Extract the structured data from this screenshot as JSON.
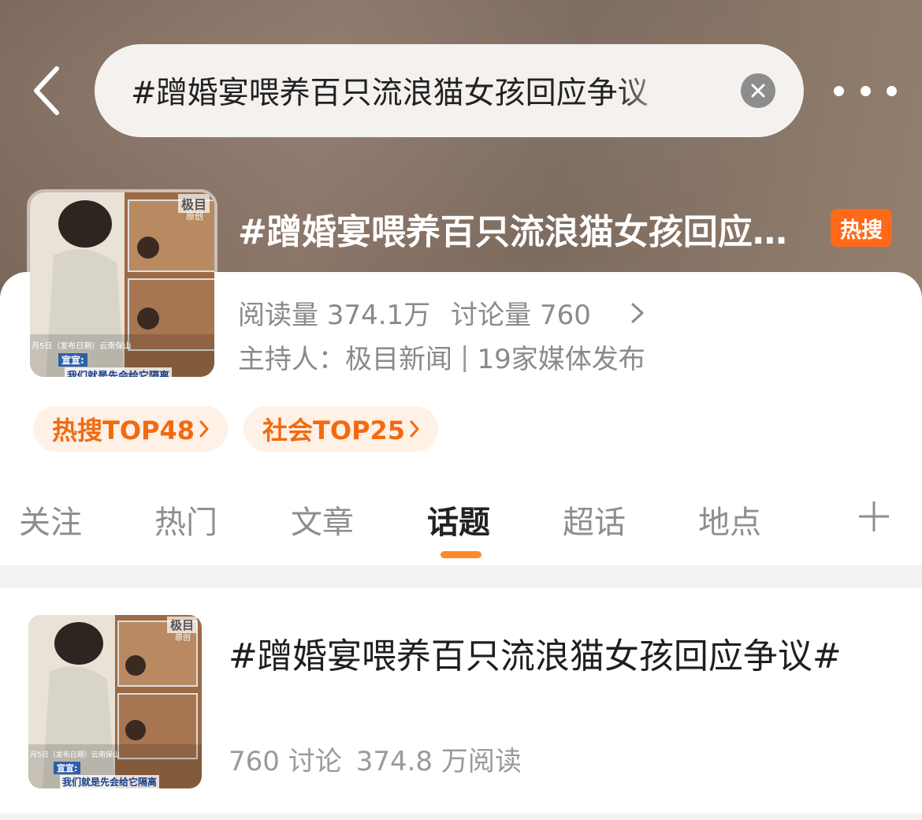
{
  "search": {
    "query": "#蹭婚宴喂养百只流浪猫女孩回应争议"
  },
  "topic": {
    "title": "#蹭婚宴喂养百只流浪猫女孩回应争议#",
    "hot_badge": "热搜",
    "read_count": "阅读量 374.1万",
    "discuss_count": "讨论量 760",
    "host_label": "主持人：极目新闻",
    "media_count": "19家媒体发布",
    "pills": [
      {
        "label": "热搜TOP48"
      },
      {
        "label": "社会TOP25"
      }
    ],
    "thumbnail": {
      "watermark": "极目",
      "tag": "原创",
      "caption_date": "月5日（发布日期）云南保山",
      "speaker": "宣宣:",
      "subtitle": "我们就是先会给它隔离"
    }
  },
  "tabs": [
    {
      "label": "关注"
    },
    {
      "label": "热门"
    },
    {
      "label": "文章"
    },
    {
      "label": "话题"
    },
    {
      "label": "超话"
    },
    {
      "label": "地点"
    }
  ],
  "result": {
    "title": "#蹭婚宴喂养百只流浪猫女孩回应争议#",
    "discussions": "760 讨论",
    "reads": "374.8 万阅读"
  },
  "colors": {
    "accent": "#ff8a2a",
    "badge": "#ff6a1a",
    "pill_text": "#f26a10",
    "pill_bg": "#fff1e6"
  },
  "icons": [
    "back-arrow-icon",
    "clear-icon",
    "more-icon",
    "chevron-right-icon",
    "plus-icon"
  ]
}
